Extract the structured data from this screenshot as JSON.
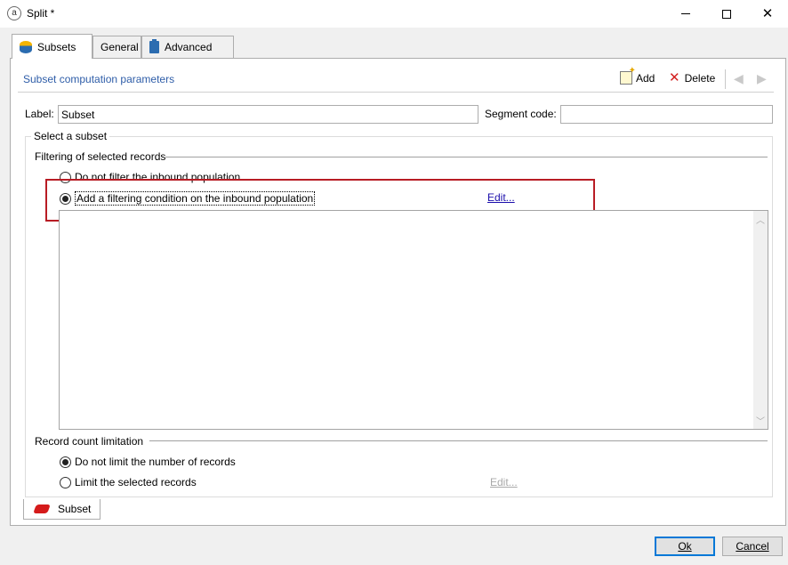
{
  "window": {
    "title": "Split *",
    "app_icon": "adobe-campaign-icon",
    "controls": {
      "minimize": "minimize-icon",
      "maximize": "maximize-icon",
      "close": "close-icon"
    }
  },
  "tabs": [
    {
      "label": "Subsets",
      "icon": "database-icon",
      "active": true
    },
    {
      "label": "General",
      "active": false
    },
    {
      "label": "Advanced",
      "icon": "clipboard-icon",
      "active": false
    }
  ],
  "toolbar": {
    "title": "Subset computation parameters",
    "add_label": "Add",
    "delete_label": "Delete",
    "icons": [
      "add-icon",
      "delete-icon",
      "previous-icon",
      "next-icon"
    ]
  },
  "form": {
    "label_caption": "Label:",
    "label_value": "Subset",
    "segment_caption": "Segment code:",
    "segment_value": ""
  },
  "subset_group": {
    "title": "Select a subset",
    "filtering": {
      "title": "Filtering of selected records",
      "options": [
        {
          "label": "Do not filter the inbound population",
          "selected": false
        },
        {
          "label": "Add a filtering condition on the inbound population",
          "selected": true
        }
      ],
      "edit_link": "Edit..."
    },
    "record_count": {
      "title": "Record count limitation",
      "options": [
        {
          "label": "Do not limit the number of records",
          "selected": true
        },
        {
          "label": "Limit the selected records",
          "selected": false
        }
      ],
      "edit_link": "Edit..."
    }
  },
  "bottom_tab": {
    "label": "Subset",
    "icon": "subset-icon"
  },
  "footer": {
    "ok_label": "Ok",
    "cancel_label": "Cancel"
  },
  "colors": {
    "highlight_box": "#b81c24",
    "link": "#1a0dab",
    "toolbar_title": "#2e5da8",
    "ok_border": "#0078d7"
  }
}
